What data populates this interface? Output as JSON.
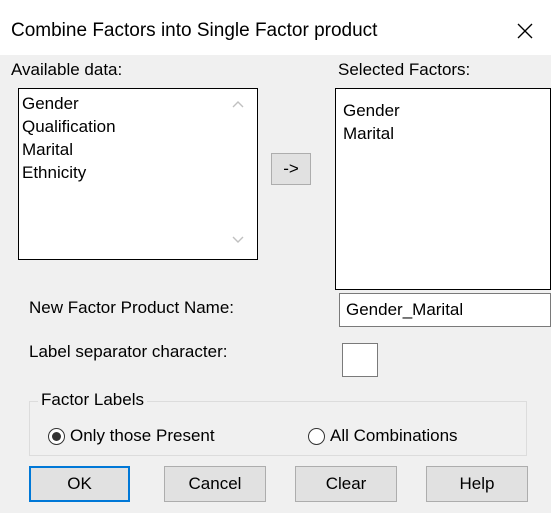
{
  "dialog": {
    "title": "Combine Factors into Single Factor product"
  },
  "available": {
    "label": "Available data:",
    "items": [
      "Gender",
      "Qualification",
      "Marital",
      "Ethnicity"
    ]
  },
  "move_button_label": "->",
  "selected": {
    "label": "Selected Factors:",
    "items": [
      "Gender",
      "Marital"
    ]
  },
  "product_name": {
    "label": "New Factor Product Name:",
    "value": "Gender_Marital"
  },
  "separator": {
    "label": "Label separator character:",
    "value": ""
  },
  "factor_labels": {
    "legend": "Factor Labels",
    "options": [
      "Only those Present",
      "All Combinations"
    ],
    "selected_index": 0
  },
  "buttons": {
    "ok": "OK",
    "cancel": "Cancel",
    "clear": "Clear",
    "help": "Help"
  }
}
